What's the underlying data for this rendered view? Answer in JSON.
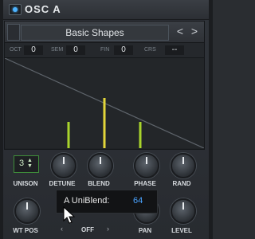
{
  "header": {
    "title": "OSC A",
    "power_icon": "power-toggle-icon",
    "accent": "#4db3ff"
  },
  "wavetable": {
    "name": "Basic Shapes",
    "prev_icon": "chevron-left-icon",
    "next_icon": "chevron-right-icon",
    "prev_glyph": "<",
    "next_glyph": ">",
    "pitch": {
      "oct_label": "OCT",
      "oct_value": "0",
      "sem_label": "SEM",
      "sem_value": "0",
      "fin_label": "FIN",
      "fin_value": "0",
      "crs_label": "CRS",
      "crs_value": "--"
    },
    "unison_voice_colors": "#a9d42c"
  },
  "controls": {
    "unison": {
      "label": "UNISON",
      "value": "3",
      "color": "#3f8d3a"
    },
    "detune": {
      "label": "DETUNE"
    },
    "blend": {
      "label": "BLEND"
    },
    "phase": {
      "label": "PHASE"
    },
    "rand": {
      "label": "RAND"
    },
    "wt_pos": {
      "label": "WT POS"
    },
    "pan": {
      "label": "PAN"
    },
    "level": {
      "label": "LEVEL"
    },
    "mode": {
      "value": "OFF",
      "left_glyph": "‹",
      "right_glyph": "›"
    }
  },
  "tooltip": {
    "label": "A UniBlend:",
    "value": "64",
    "value_color": "#4aa3ff"
  }
}
